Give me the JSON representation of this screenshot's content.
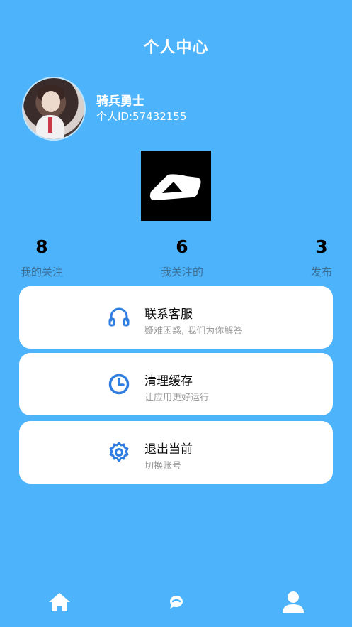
{
  "header": {
    "title": "个人中心"
  },
  "profile": {
    "name": "骑兵勇士",
    "id_text": "个人ID:57432155"
  },
  "stats": [
    {
      "value": "8",
      "label": "我的关注"
    },
    {
      "value": "6",
      "label": "我关注的"
    },
    {
      "value": "3",
      "label": "发布"
    }
  ],
  "menu": [
    {
      "title": "联系客服",
      "subtitle": "疑难困惑, 我们为你解答",
      "icon": "headset-icon"
    },
    {
      "title": "清理缓存",
      "subtitle": "让应用更好运行",
      "icon": "clock-icon"
    },
    {
      "title": "退出当前",
      "subtitle": "切换账号",
      "icon": "gear-icon"
    }
  ],
  "tabbar": {
    "items": [
      "home-icon",
      "chat-icon",
      "user-icon"
    ]
  },
  "colors": {
    "background": "#4db3fb",
    "accent": "#2f7de1",
    "card": "#ffffff"
  }
}
